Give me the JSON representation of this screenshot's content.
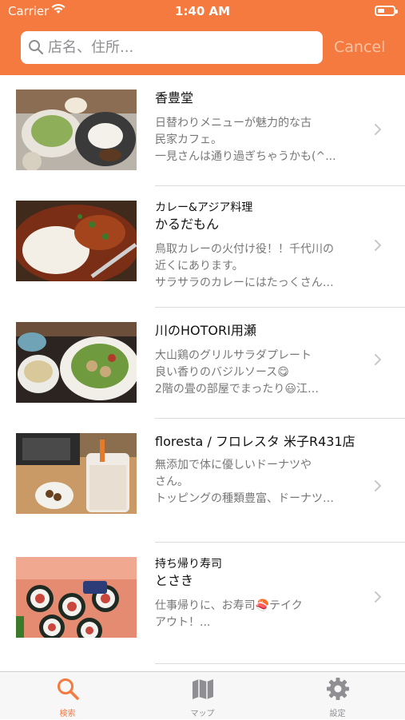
{
  "status_bar": {
    "carrier": "Carrier",
    "time": "1:40 AM"
  },
  "search": {
    "placeholder": "店名、住所...",
    "value": "",
    "cancel_label": "Cancel"
  },
  "colors": {
    "accent": "#F47A3F",
    "cancel_text": "#FBC3A5",
    "separator": "#DCDCDC"
  },
  "restaurants": [
    {
      "category": "",
      "name": "香豊堂",
      "desc": [
        "日替わりメニューが魅力的な古",
        "民家カフェ。",
        "一見さんは通り過ぎちゃうかも(^..."
      ]
    },
    {
      "category": "カレー&アジア料理",
      "name": "かるだもん",
      "desc": [
        "鳥取カレーの火付け役！！千代川の",
        "近くにあります。",
        "サラサラのカレーにはたっくさん…"
      ]
    },
    {
      "category": "",
      "name": "川のHOTORI用瀬",
      "desc": [
        "大山鶏のグリルサラダプレート",
        "良い香りのバジルソース😋",
        "2階の畳の部屋でまったり😃江…"
      ]
    },
    {
      "category": "",
      "name": "floresta / フロレスタ 米子R431店",
      "desc": [
        "無添加で体に優しいドーナツや",
        "さん。",
        "トッピングの種類豊富、ドーナツ…"
      ]
    },
    {
      "category": "持ち帰り寿司",
      "name": "とさき",
      "desc": [
        "仕事帰りに、お寿司🍣テイク",
        "アウト！..."
      ]
    }
  ],
  "tabs": [
    {
      "label": "検索",
      "icon": "search-icon",
      "active": true
    },
    {
      "label": "マップ",
      "icon": "map-icon",
      "active": false
    },
    {
      "label": "設定",
      "icon": "gear-icon",
      "active": false
    }
  ]
}
